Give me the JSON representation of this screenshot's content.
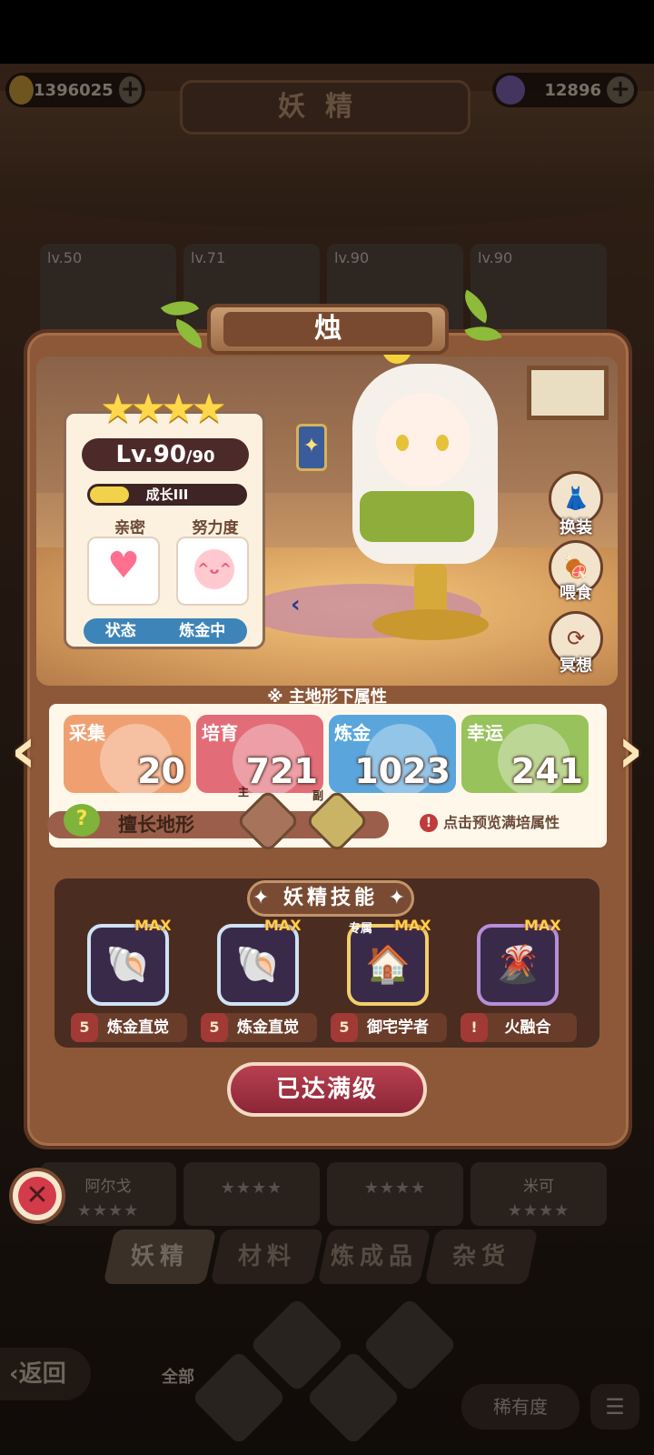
{
  "top_bar": {
    "gold": "1396025",
    "gems": "12896",
    "page_title": "妖精"
  },
  "background_cards": [
    {
      "level": "lv.50"
    },
    {
      "level": "lv.71"
    },
    {
      "level": "lv.90"
    },
    {
      "level": "lv.90"
    }
  ],
  "background_names": [
    {
      "name": "阿尔戈",
      "stars": "★★★★"
    },
    {
      "name": "",
      "stars": "★★★★"
    },
    {
      "name": "",
      "stars": "★★★★"
    },
    {
      "name": "米可",
      "stars": "★★★★"
    }
  ],
  "fairy": {
    "name": "烛",
    "stars": "★★★★",
    "level": "Lv.90",
    "max_level": "/90",
    "growth_label": "成长III",
    "growth_progress": 0.25,
    "intimacy_label": "亲密",
    "effort_label": "努力度",
    "status_label": "状态",
    "status_value": "炼金中"
  },
  "actions": [
    {
      "label": "换装",
      "icon": "dress-icon"
    },
    {
      "label": "喂食",
      "icon": "meat-icon"
    },
    {
      "label": "冥想",
      "icon": "meditate-icon"
    }
  ],
  "attributes": {
    "header": "※ 主地形下属性",
    "items": [
      {
        "label": "采集",
        "value": "20",
        "color": "#f0a070"
      },
      {
        "label": "培育",
        "value": "721",
        "color": "#e26c78"
      },
      {
        "label": "炼金",
        "value": "1023",
        "color": "#5aa6dc"
      },
      {
        "label": "幸运",
        "value": "241",
        "color": "#98c25c"
      }
    ],
    "terrain_label": "擅长地形",
    "main_tag": "主",
    "sub_tag": "副",
    "hint": "点击预览满培属性"
  },
  "skills": {
    "title": "妖精技能",
    "items": [
      {
        "name": "炼金直觉",
        "badge": "5",
        "max": "MAX",
        "tag": "",
        "glyph": "🐚",
        "frame": "#cfe3f7"
      },
      {
        "name": "炼金直觉",
        "badge": "5",
        "max": "MAX",
        "tag": "",
        "glyph": "🐚",
        "frame": "#cfe3f7"
      },
      {
        "name": "御宅学者",
        "badge": "5",
        "max": "MAX",
        "tag": "专属",
        "glyph": "🏠",
        "frame": "#f2cf6a"
      },
      {
        "name": "火融合",
        "badge": "!",
        "max": "MAX",
        "tag": "",
        "glyph": "🌋",
        "frame": "#b58fd8"
      }
    ]
  },
  "maxed_button": "已达满级",
  "bottom": {
    "tabs": [
      "妖精",
      "材料",
      "炼成品",
      "杂货"
    ],
    "back_label": "返回",
    "filter_all": "全部",
    "rarity_label": "稀有度"
  }
}
